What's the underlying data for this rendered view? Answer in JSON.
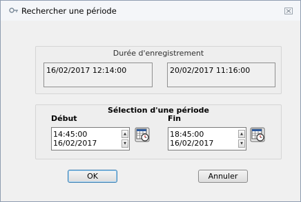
{
  "window": {
    "title": "Rechercher une période",
    "close_glyph": "⊠"
  },
  "recording": {
    "title": "Durée d'enregistrement",
    "start": "16/02/2017 12:14:00",
    "end": "20/02/2017 11:16:00"
  },
  "selection": {
    "title": "Sélection d'une période",
    "start": {
      "label": "Début",
      "time": "14:45:00",
      "date": "16/02/2017"
    },
    "end": {
      "label": "Fin",
      "time": "18:45:00",
      "date": "16/02/2017"
    }
  },
  "buttons": {
    "ok": "OK",
    "cancel": "Annuler"
  },
  "icons": {
    "app": "app-key-icon",
    "close": "close-icon",
    "calendar": "calendar-clock-icon",
    "spin_up": "spin-up-icon",
    "spin_down": "spin-down-icon"
  }
}
